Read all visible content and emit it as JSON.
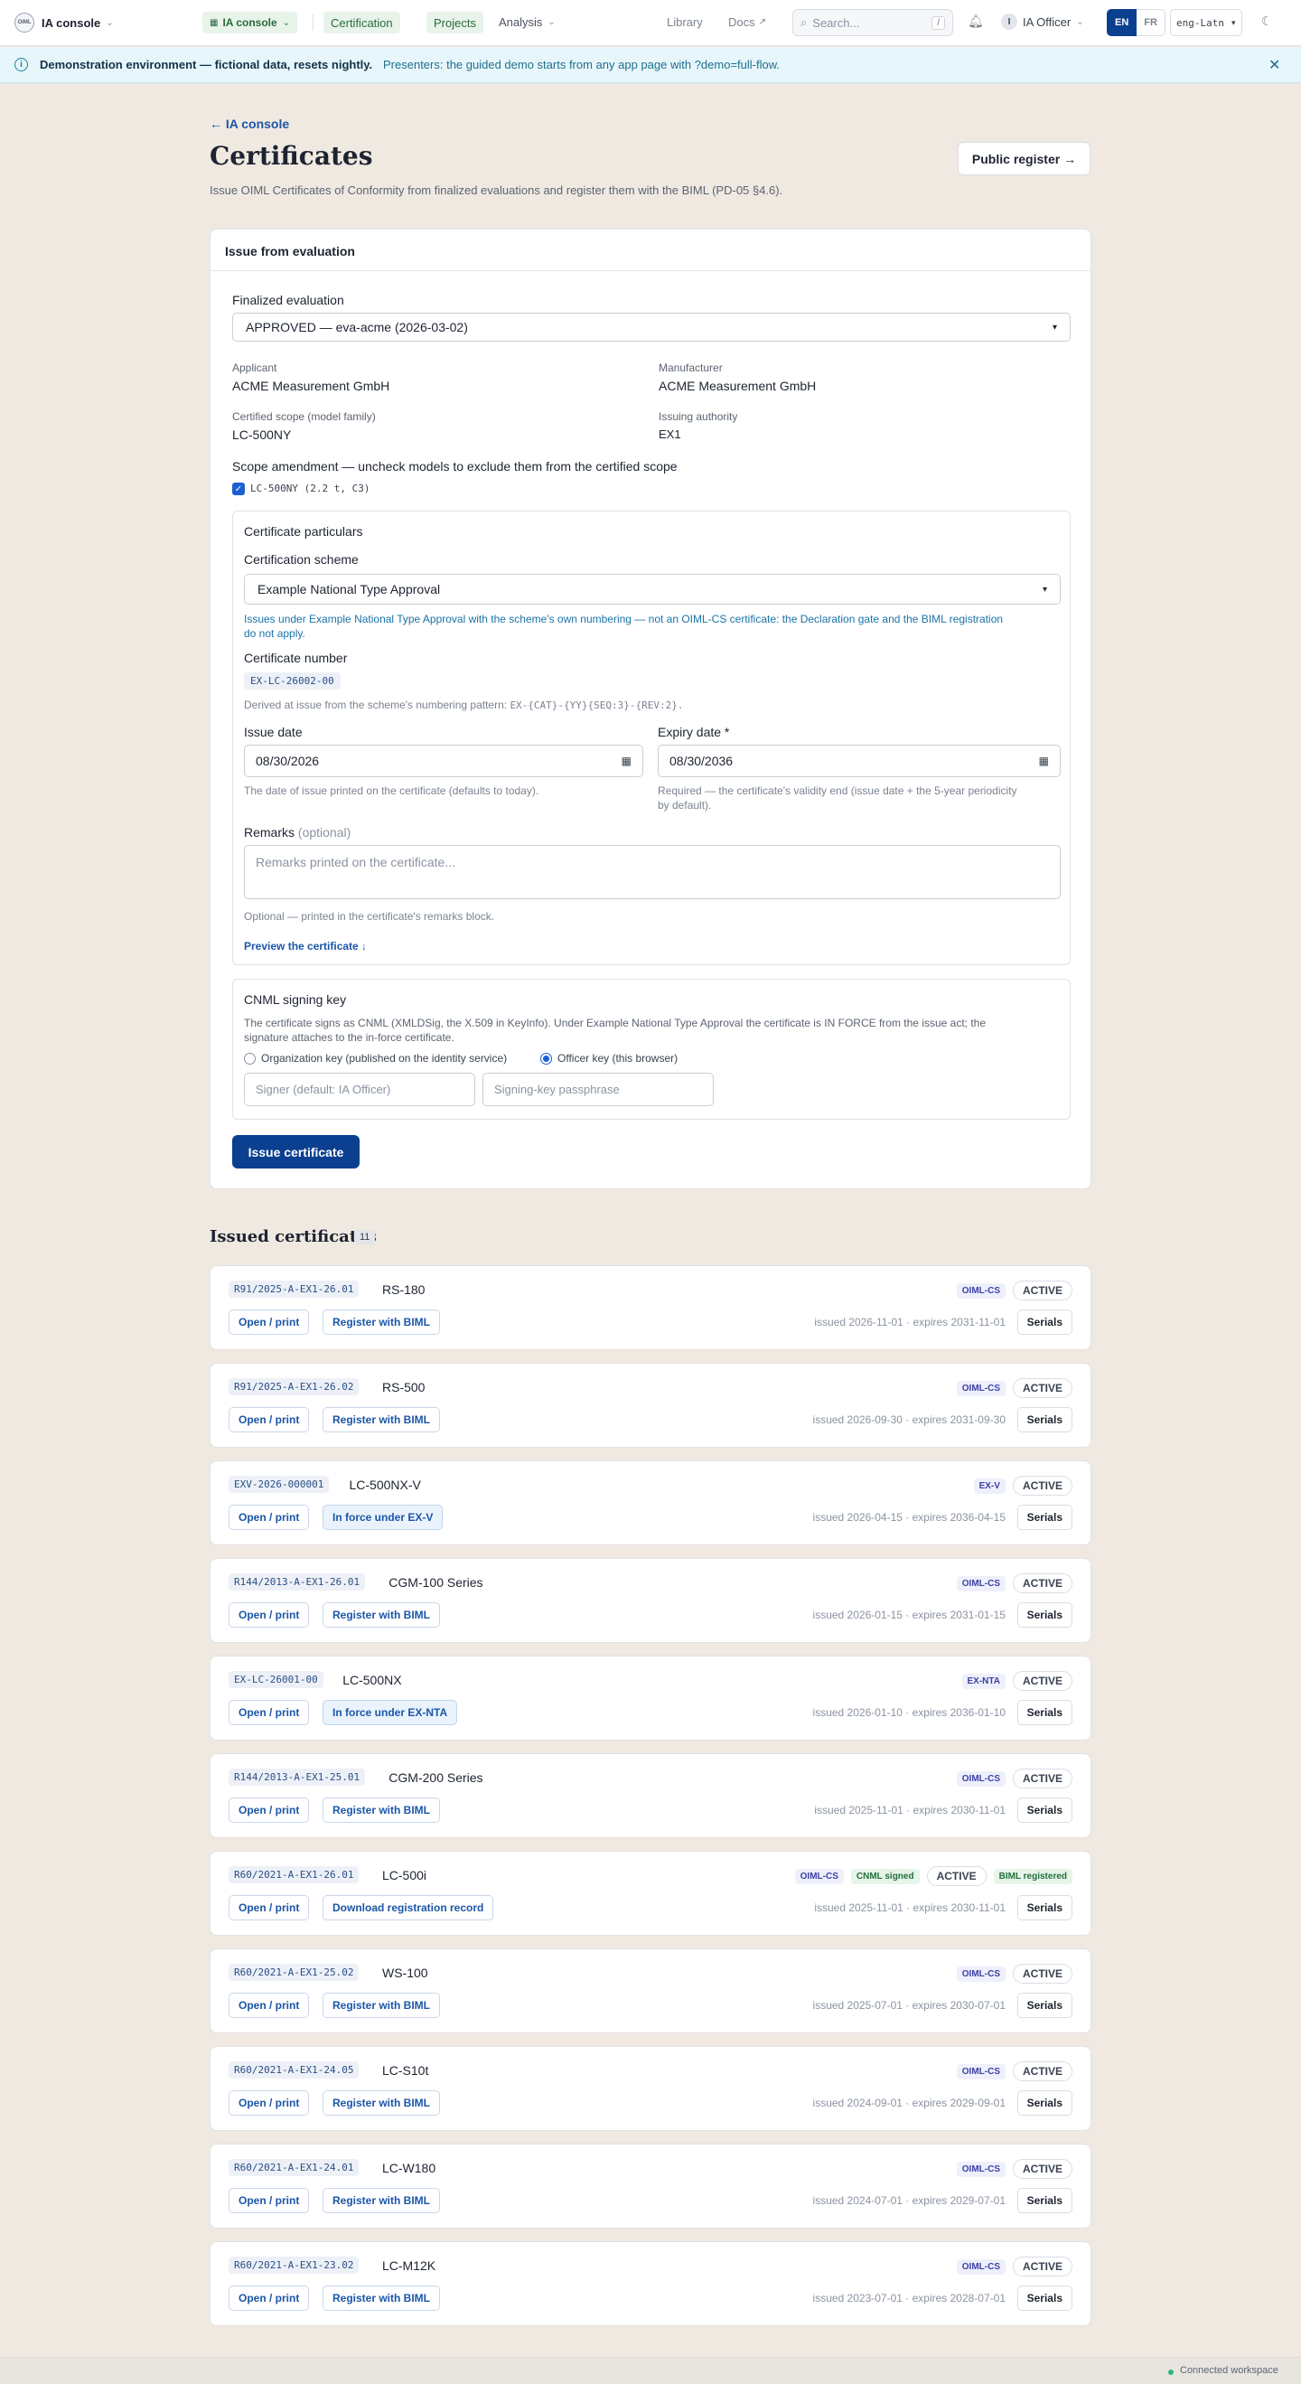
{
  "nav": {
    "brand": "IA console",
    "logo_text": "OIML",
    "app_pill": "IA console",
    "certification": "Certification",
    "projects": "Projects",
    "analysis": "Analysis",
    "library": "Library",
    "docs": "Docs",
    "search_placeholder": "Search...",
    "search_kbd": "/",
    "user_initial": "I",
    "user": "IA Officer",
    "lang_en": "EN",
    "lang_fr": "FR",
    "script": "eng-Latn"
  },
  "banner": {
    "strong": "Demonstration environment — fictional data, resets nightly.",
    "text": "Presenters: the guided demo starts from any app page with ?demo=full-flow."
  },
  "header": {
    "back": "← IA console",
    "title": "Certificates",
    "subtitle": "Issue OIML Certificates of Conformity from finalized evaluations and register them with the BIML (PD-05 §4.6).",
    "public_register": "Public register →"
  },
  "issue": {
    "heading": "Issue from evaluation",
    "finalized_label": "Finalized evaluation",
    "finalized_value": "APPROVED — eva-acme (2026-03-02)",
    "applicant_label": "Applicant",
    "applicant": "ACME Measurement GmbH",
    "manufacturer_label": "Manufacturer",
    "manufacturer": "ACME Measurement GmbH",
    "scope_label": "Certified scope (model family)",
    "scope": "LC-500NY",
    "authority_label": "Issuing authority",
    "authority": "EX1",
    "amend_label": "Scope amendment — uncheck models to exclude them from the certified scope",
    "amend_item": "LC-500NY (2.2 t, C3)",
    "particulars": "Certificate particulars",
    "scheme_label": "Certification scheme",
    "scheme_value": "Example National Type Approval",
    "scheme_note_1": "Issues under Example National Type Approval with the scheme's own numbering — not an OIML-CS certificate: the Declaration gate and the BIML registration",
    "scheme_note_2": "do not apply.",
    "number_label": "Certificate number",
    "number": "EX-LC-26002-00",
    "number_hint_prefix": "Derived at issue from the scheme's numbering pattern: ",
    "number_pattern": "EX-{CAT}-{YY}{SEQ:3}-{REV:2}.",
    "issue_date_label": "Issue date",
    "issue_date": "08/30/2026",
    "issue_date_hint": "The date of issue printed on the certificate (defaults to today).",
    "expiry_label": "Expiry date *",
    "expiry_date": "08/30/2036",
    "expiry_hint_1": "Required — the certificate's validity end (issue date + the 5-year periodicity",
    "expiry_hint_2": "by default).",
    "remarks_label": "Remarks",
    "remarks_optional": "(optional)",
    "remarks_placeholder": "Remarks printed on the certificate...",
    "remarks_hint": "Optional — printed in the certificate's remarks block.",
    "preview": "Preview the certificate ↓",
    "cnml_title": "CNML signing key",
    "cnml_text_1": "The certificate signs as CNML (XMLDSig, the X.509 in KeyInfo). Under Example National Type Approval the certificate is IN FORCE from the issue act; the",
    "cnml_text_2": "signature attaches to the in-force certificate.",
    "org_key": "Organization key (published on the identity service)",
    "officer_key": "Officer key (this browser)",
    "signer_placeholder": "Signer (default: IA Officer)",
    "passphrase_placeholder": "Signing-key passphrase",
    "issue_button": "Issue certificate"
  },
  "issued": {
    "title": "Issued certificates",
    "count": "11",
    "open_label": "Open / print",
    "register_label": "Register with BIML",
    "serials_label": "Serials",
    "items": [
      {
        "code": "R91/2025-A-EX1-26.01",
        "model": "RS-180",
        "scheme": "OIML-CS",
        "status": "ACTIVE",
        "action": "Register with BIML",
        "dates": "issued 2026-11-01 · expires 2031-11-01"
      },
      {
        "code": "R91/2025-A-EX1-26.02",
        "model": "RS-500",
        "scheme": "OIML-CS",
        "status": "ACTIVE",
        "action": "Register with BIML",
        "dates": "issued 2026-09-30 · expires 2031-09-30"
      },
      {
        "code": "EXV-2026-000001",
        "model": "LC-500NX-V",
        "scheme": "EX-V",
        "status": "ACTIVE",
        "action": "In force under EX-V",
        "dates": "issued 2026-04-15 · expires 2036-04-15"
      },
      {
        "code": "R144/2013-A-EX1-26.01",
        "model": "CGM-100 Series",
        "scheme": "OIML-CS",
        "status": "ACTIVE",
        "action": "Register with BIML",
        "dates": "issued 2026-01-15 · expires 2031-01-15"
      },
      {
        "code": "EX-LC-26001-00",
        "model": "LC-500NX",
        "scheme": "EX-NTA",
        "status": "ACTIVE",
        "action": "In force under EX-NTA",
        "dates": "issued 2026-01-10 · expires 2036-01-10"
      },
      {
        "code": "R144/2013-A-EX1-25.01",
        "model": "CGM-200 Series",
        "scheme": "OIML-CS",
        "status": "ACTIVE",
        "action": "Register with BIML",
        "dates": "issued 2025-11-01 · expires 2030-11-01"
      },
      {
        "code": "R60/2021-A-EX1-26.01",
        "model": "LC-500i",
        "scheme": "OIML-CS",
        "signed": "CNML signed",
        "status": "ACTIVE",
        "registered": "BIML registered",
        "action": "Download registration record",
        "dates": "issued 2025-11-01 · expires 2030-11-01"
      },
      {
        "code": "R60/2021-A-EX1-25.02",
        "model": "WS-100",
        "scheme": "OIML-CS",
        "status": "ACTIVE",
        "action": "Register with BIML",
        "dates": "issued 2025-07-01 · expires 2030-07-01"
      },
      {
        "code": "R60/2021-A-EX1-24.05",
        "model": "LC-S10t",
        "scheme": "OIML-CS",
        "status": "ACTIVE",
        "action": "Register with BIML",
        "dates": "issued 2024-09-01 · expires 2029-09-01"
      },
      {
        "code": "R60/2021-A-EX1-24.01",
        "model": "LC-W180",
        "scheme": "OIML-CS",
        "status": "ACTIVE",
        "action": "Register with BIML",
        "dates": "issued 2024-07-01 · expires 2029-07-01"
      },
      {
        "code": "R60/2021-A-EX1-23.02",
        "model": "LC-M12K",
        "scheme": "OIML-CS",
        "status": "ACTIVE",
        "action": "Register with BIML",
        "dates": "issued 2023-07-01 · expires 2028-07-01"
      }
    ]
  },
  "footer": {
    "status": "Connected workspace",
    "status_color": "#2bb57a"
  }
}
